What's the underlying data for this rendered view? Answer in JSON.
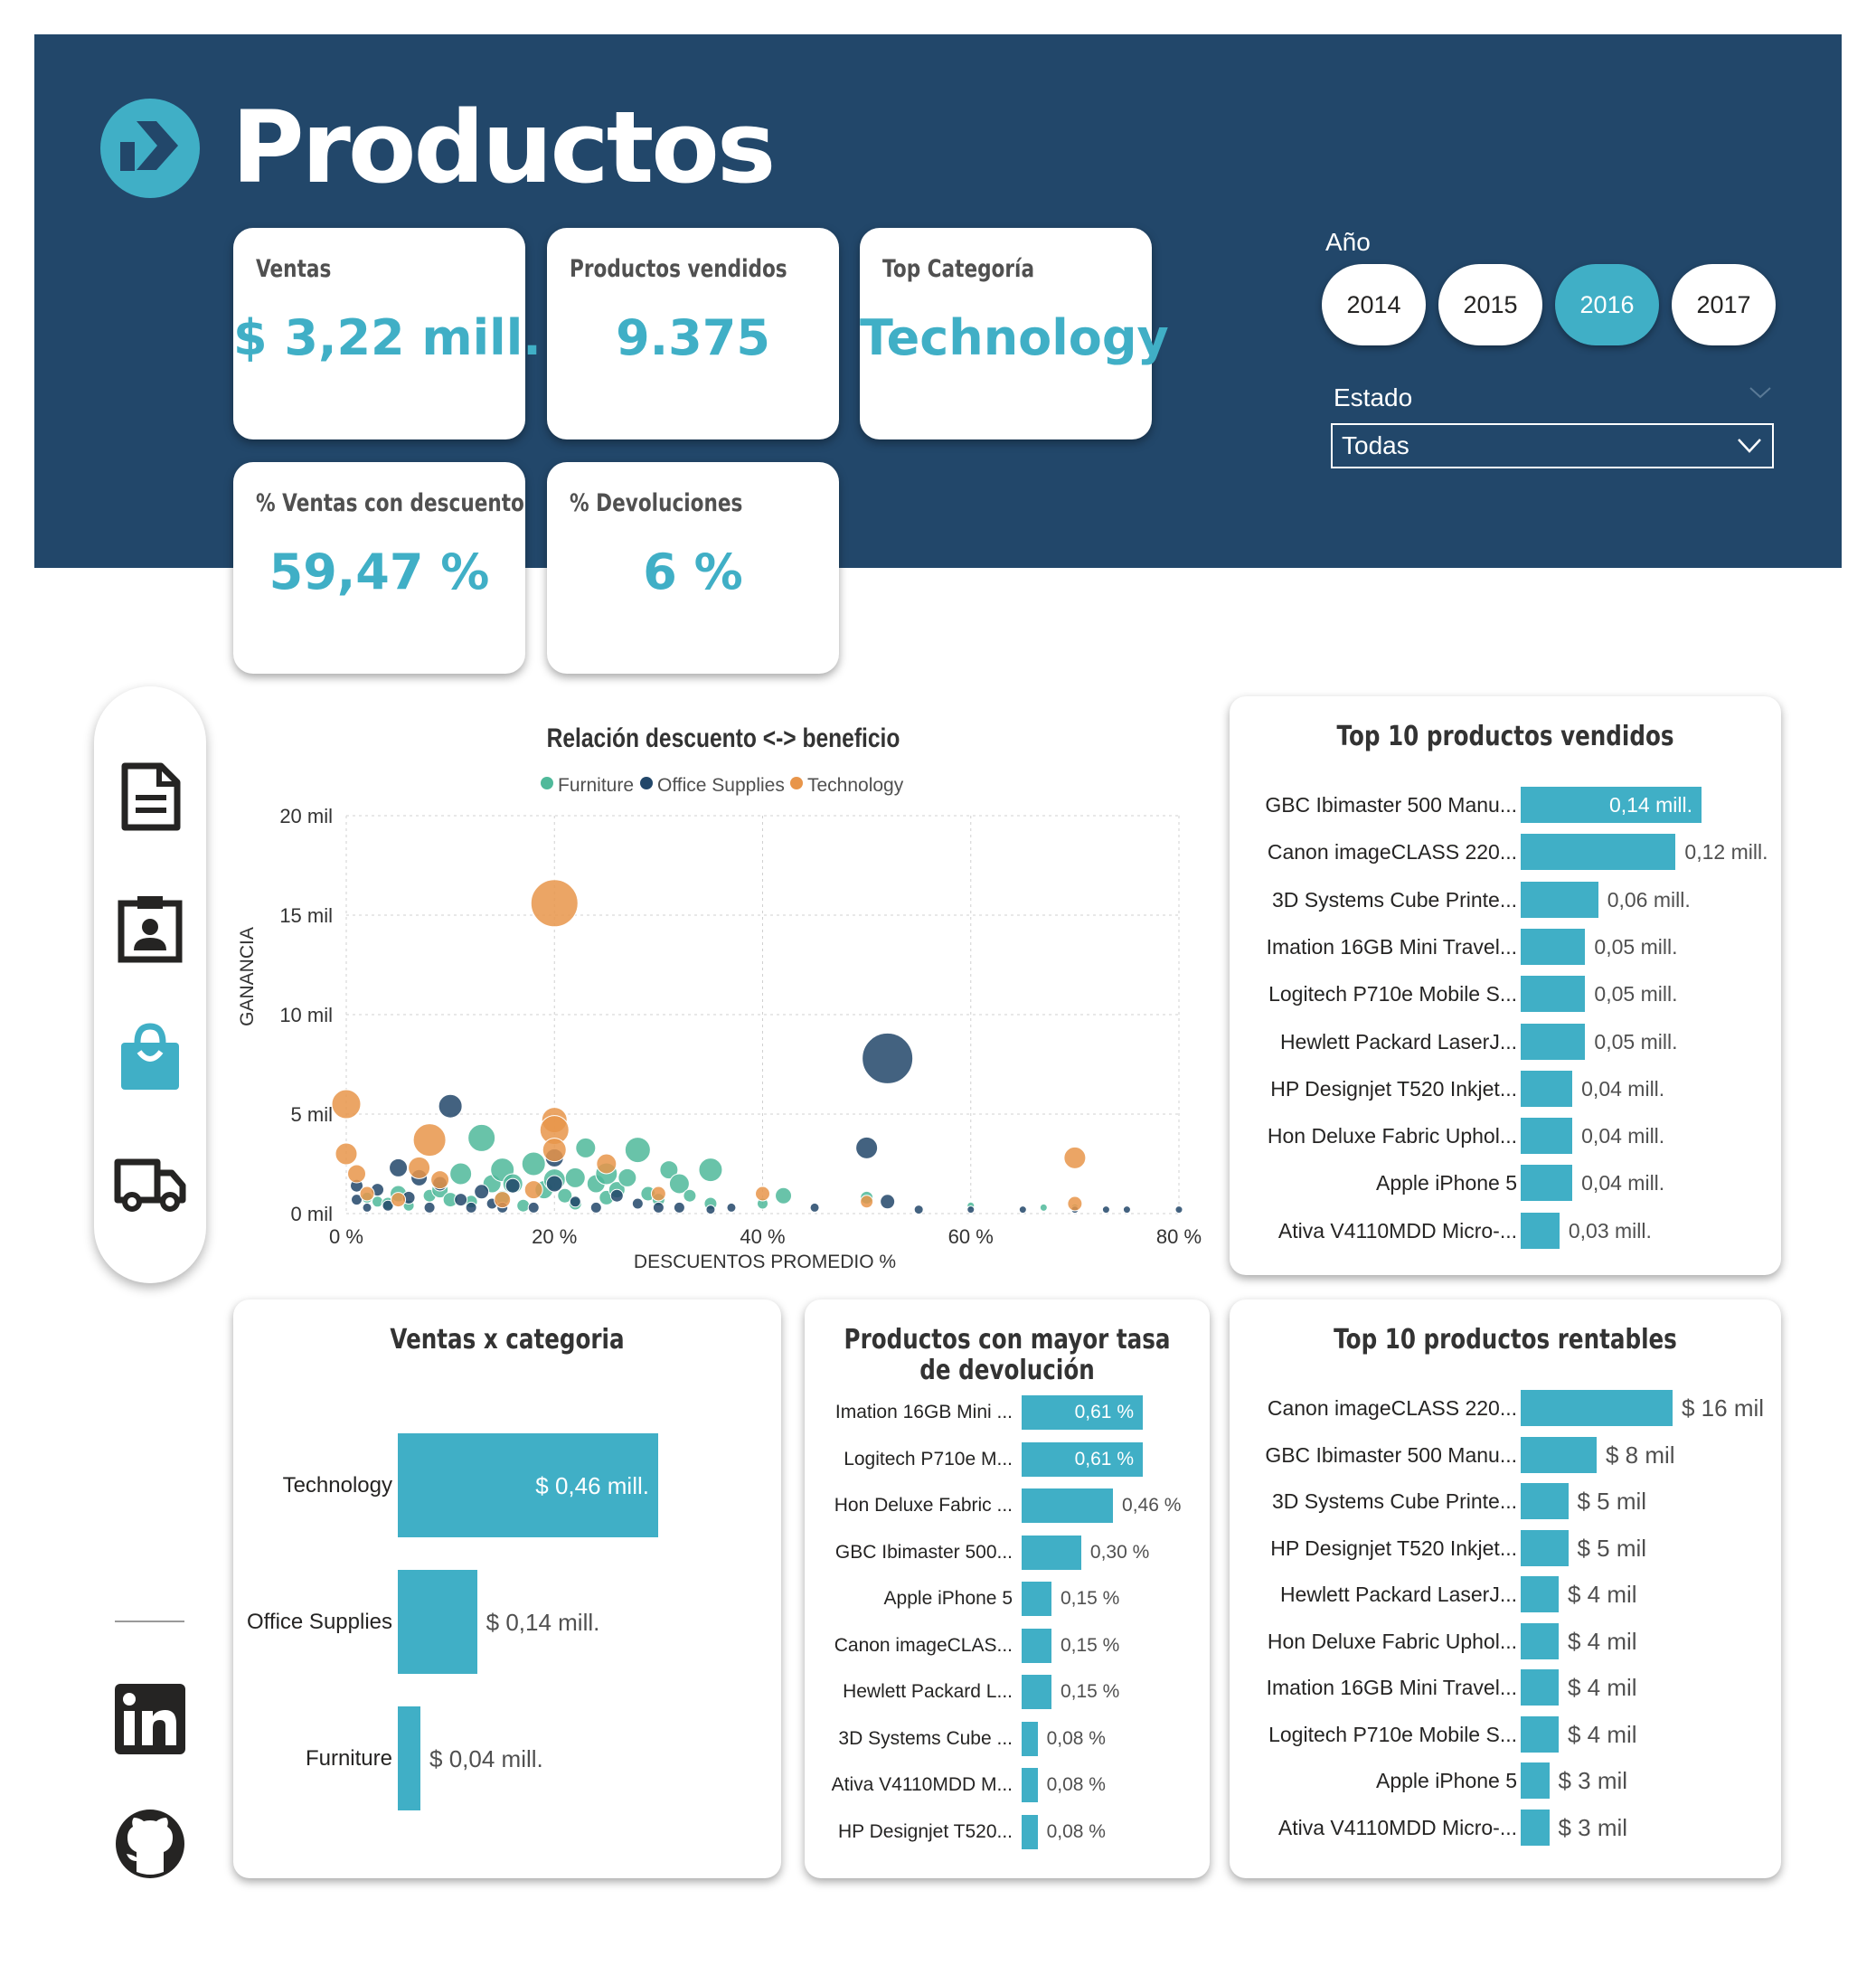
{
  "page_title": "Productos",
  "colors": {
    "header_bg": "#22476a",
    "accent": "#40afc6",
    "furniture": "#4fb99a",
    "office_supplies": "#22476a",
    "technology": "#e8954a"
  },
  "kpis": {
    "ventas": {
      "label": "Ventas",
      "value": "$ 3,22 mill."
    },
    "productos_vendidos": {
      "label": "Productos vendidos",
      "value": "9.375"
    },
    "top_categoria": {
      "label": "Top Categoría",
      "value": "Technology"
    },
    "pct_descuento": {
      "label": "% Ventas con descuento",
      "value": "59,47 %"
    },
    "pct_devoluciones": {
      "label": "% Devoluciones",
      "value": "6 %"
    }
  },
  "filters": {
    "year_label": "Año",
    "years": [
      "2014",
      "2015",
      "2016",
      "2017"
    ],
    "selected_year": "2016",
    "estado_label": "Estado",
    "estado_value": "Todas"
  },
  "nav_icons": [
    "document-icon",
    "contact-badge-icon",
    "shopping-bag-icon",
    "truck-icon"
  ],
  "social_icons": [
    "linkedin-icon",
    "github-icon"
  ],
  "scatter": {
    "title": "Relación descuento <-> beneficio",
    "legend": [
      "Furniture",
      "Office Supplies",
      "Technology"
    ],
    "xlabel": "DESCUENTOS PROMEDIO %",
    "ylabel": "GANANCIA",
    "x_ticks": [
      "0 %",
      "20 %",
      "40 %",
      "60 %",
      "80 %"
    ],
    "y_ticks": [
      "0 mil",
      "5 mil",
      "10 mil",
      "15 mil",
      "20 mil"
    ]
  },
  "top_vendidos": {
    "title": "Top 10 productos vendidos",
    "items": [
      {
        "label": "GBC Ibimaster 500 Manu...",
        "value": "0,14 mill."
      },
      {
        "label": "Canon imageCLASS 220...",
        "value": "0,12 mill."
      },
      {
        "label": "3D Systems Cube Printe...",
        "value": "0,06 mill."
      },
      {
        "label": "Imation 16GB Mini Travel...",
        "value": "0,05 mill."
      },
      {
        "label": "Logitech P710e Mobile S...",
        "value": "0,05 mill."
      },
      {
        "label": "Hewlett Packard LaserJ...",
        "value": "0,05 mill."
      },
      {
        "label": "HP Designjet T520 Inkjet...",
        "value": "0,04 mill."
      },
      {
        "label": "Hon Deluxe Fabric Uphol...",
        "value": "0,04 mill."
      },
      {
        "label": "Apple iPhone 5",
        "value": "0,04 mill."
      },
      {
        "label": "Ativa V4110MDD Micro-...",
        "value": "0,03 mill."
      }
    ]
  },
  "ventas_categoria": {
    "title": "Ventas x categoria",
    "items": [
      {
        "label": "Technology",
        "value": "$ 0,46 mill."
      },
      {
        "label": "Office Supplies",
        "value": "$ 0,14 mill."
      },
      {
        "label": "Furniture",
        "value": "$ 0,04 mill."
      }
    ]
  },
  "devolucion": {
    "title_line1": "Productos con mayor tasa",
    "title_line2": "de devolución",
    "items": [
      {
        "label": "Imation 16GB Mini ...",
        "value": "0,61 %"
      },
      {
        "label": "Logitech P710e M...",
        "value": "0,61 %"
      },
      {
        "label": "Hon Deluxe Fabric ...",
        "value": "0,46 %"
      },
      {
        "label": "GBC Ibimaster 500...",
        "value": "0,30 %"
      },
      {
        "label": "Apple iPhone 5",
        "value": "0,15 %"
      },
      {
        "label": "Canon imageCLAS...",
        "value": "0,15 %"
      },
      {
        "label": "Hewlett Packard L...",
        "value": "0,15 %"
      },
      {
        "label": "3D Systems Cube ...",
        "value": "0,08 %"
      },
      {
        "label": "Ativa V4110MDD M...",
        "value": "0,08 %"
      },
      {
        "label": "HP Designjet T520...",
        "value": "0,08 %"
      }
    ]
  },
  "top_rentables": {
    "title": "Top 10 productos rentables",
    "items": [
      {
        "label": "Canon imageCLASS 220...",
        "value": "$ 16 mil"
      },
      {
        "label": "GBC Ibimaster 500 Manu...",
        "value": "$ 8 mil"
      },
      {
        "label": "3D Systems Cube Printe...",
        "value": "$ 5 mil"
      },
      {
        "label": "HP Designjet T520 Inkjet...",
        "value": "$ 5 mil"
      },
      {
        "label": "Hewlett Packard LaserJ...",
        "value": "$ 4 mil"
      },
      {
        "label": "Hon Deluxe Fabric Uphol...",
        "value": "$ 4 mil"
      },
      {
        "label": "Imation 16GB Mini Travel...",
        "value": "$ 4 mil"
      },
      {
        "label": "Logitech P710e Mobile S...",
        "value": "$ 4 mil"
      },
      {
        "label": "Apple iPhone 5",
        "value": "$ 3 mil"
      },
      {
        "label": "Ativa V4110MDD Micro-...",
        "value": "$ 3 mil"
      }
    ]
  },
  "chart_data": [
    {
      "type": "scatter",
      "title": "Relación descuento <-> beneficio",
      "xlabel": "DESCUENTOS PROMEDIO %",
      "ylabel": "GANANCIA",
      "xlim": [
        0,
        80
      ],
      "ylim": [
        0,
        20000
      ],
      "grid": true,
      "legend": "top",
      "series": [
        {
          "name": "Furniture",
          "points": [
            [
              2,
              800,
              6
            ],
            [
              3,
              600,
              6
            ],
            [
              4,
              500,
              7
            ],
            [
              5,
              1000,
              9
            ],
            [
              6,
              400,
              6
            ],
            [
              8,
              900,
              7
            ],
            [
              9,
              1200,
              9
            ],
            [
              10,
              700,
              8
            ],
            [
              11,
              2000,
              12
            ],
            [
              12,
              600,
              7
            ],
            [
              13,
              3800,
              15
            ],
            [
              14,
              1500,
              10
            ],
            [
              15,
              2200,
              13
            ],
            [
              15,
              800,
              8
            ],
            [
              16,
              1500,
              11
            ],
            [
              17,
              400,
              7
            ],
            [
              18,
              2500,
              13
            ],
            [
              19,
              1200,
              10
            ],
            [
              20,
              1700,
              12
            ],
            [
              21,
              900,
              8
            ],
            [
              22,
              1800,
              11
            ],
            [
              22,
              500,
              7
            ],
            [
              23,
              3300,
              11
            ],
            [
              24,
              1500,
              10
            ],
            [
              25,
              2000,
              12
            ],
            [
              25,
              800,
              8
            ],
            [
              26,
              1200,
              9
            ],
            [
              27,
              1800,
              10
            ],
            [
              28,
              3200,
              14
            ],
            [
              29,
              1000,
              8
            ],
            [
              30,
              700,
              7
            ],
            [
              31,
              2200,
              10
            ],
            [
              32,
              1500,
              11
            ],
            [
              33,
              900,
              7
            ],
            [
              35,
              500,
              7
            ],
            [
              35,
              2200,
              13
            ],
            [
              40,
              500,
              6
            ],
            [
              42,
              900,
              9
            ],
            [
              50,
              800,
              7
            ],
            [
              60,
              400,
              4
            ],
            [
              67,
              300,
              4
            ],
            [
              70,
              300,
              4
            ]
          ]
        },
        {
          "name": "Office Supplies",
          "points": [
            [
              1,
              1400,
              7
            ],
            [
              1,
              700,
              6
            ],
            [
              2,
              300,
              5
            ],
            [
              3,
              1200,
              7
            ],
            [
              4,
              400,
              6
            ],
            [
              5,
              2300,
              10
            ],
            [
              6,
              800,
              7
            ],
            [
              7,
              1800,
              9
            ],
            [
              8,
              300,
              6
            ],
            [
              9,
              1500,
              8
            ],
            [
              10,
              5400,
              13
            ],
            [
              11,
              700,
              7
            ],
            [
              12,
              300,
              6
            ],
            [
              13,
              1100,
              8
            ],
            [
              14,
              500,
              6
            ],
            [
              15,
              300,
              6
            ],
            [
              16,
              1400,
              8
            ],
            [
              18,
              300,
              6
            ],
            [
              20,
              2800,
              10
            ],
            [
              20,
              1500,
              9
            ],
            [
              22,
              600,
              6
            ],
            [
              24,
              300,
              6
            ],
            [
              26,
              900,
              7
            ],
            [
              28,
              500,
              6
            ],
            [
              30,
              300,
              6
            ],
            [
              32,
              300,
              6
            ],
            [
              35,
              200,
              5
            ],
            [
              37,
              300,
              5
            ],
            [
              45,
              300,
              5
            ],
            [
              50,
              3300,
              12
            ],
            [
              52,
              7800,
              28
            ],
            [
              52,
              600,
              8
            ],
            [
              55,
              200,
              5
            ],
            [
              60,
              200,
              4
            ],
            [
              65,
              200,
              4
            ],
            [
              70,
              200,
              4
            ],
            [
              73,
              200,
              4
            ],
            [
              75,
              200,
              4
            ],
            [
              80,
              200,
              4
            ]
          ]
        },
        {
          "name": "Technology",
          "points": [
            [
              0,
              5500,
              16
            ],
            [
              0,
              3000,
              12
            ],
            [
              1,
              2000,
              10
            ],
            [
              2,
              1000,
              8
            ],
            [
              5,
              700,
              8
            ],
            [
              7,
              2300,
              12
            ],
            [
              8,
              3700,
              18
            ],
            [
              9,
              1700,
              10
            ],
            [
              15,
              700,
              9
            ],
            [
              18,
              1200,
              10
            ],
            [
              20,
              15600,
              26
            ],
            [
              20,
              4700,
              14
            ],
            [
              20,
              4200,
              16
            ],
            [
              20,
              3200,
              13
            ],
            [
              25,
              2500,
              11
            ],
            [
              30,
              1000,
              8
            ],
            [
              40,
              1000,
              8
            ],
            [
              50,
              600,
              7
            ],
            [
              70,
              2800,
              12
            ],
            [
              70,
              500,
              8
            ]
          ]
        }
      ]
    },
    {
      "type": "bar",
      "title": "Top 10 productos vendidos",
      "categories": [
        "GBC Ibimaster 500 Manu...",
        "Canon imageCLASS 220...",
        "3D Systems Cube Printe...",
        "Imation 16GB Mini Travel...",
        "Logitech P710e Mobile S...",
        "Hewlett Packard LaserJ...",
        "HP Designjet T520 Inkjet...",
        "Hon Deluxe Fabric Uphol...",
        "Apple iPhone 5",
        "Ativa V4110MDD Micro-..."
      ],
      "values": [
        0.14,
        0.12,
        0.06,
        0.05,
        0.05,
        0.05,
        0.04,
        0.04,
        0.04,
        0.03
      ]
    },
    {
      "type": "bar",
      "title": "Ventas x categoria",
      "categories": [
        "Technology",
        "Office Supplies",
        "Furniture"
      ],
      "values": [
        0.46,
        0.14,
        0.04
      ]
    },
    {
      "type": "bar",
      "title": "Productos con mayor tasa de devolución",
      "categories": [
        "Imation 16GB Mini ...",
        "Logitech P710e M...",
        "Hon Deluxe Fabric ...",
        "GBC Ibimaster 500...",
        "Apple iPhone 5",
        "Canon imageCLAS...",
        "Hewlett Packard L...",
        "3D Systems Cube ...",
        "Ativa V4110MDD M...",
        "HP Designjet T520..."
      ],
      "values": [
        0.61,
        0.61,
        0.46,
        0.3,
        0.15,
        0.15,
        0.15,
        0.08,
        0.08,
        0.08
      ]
    },
    {
      "type": "bar",
      "title": "Top 10 productos rentables",
      "categories": [
        "Canon imageCLASS 220...",
        "GBC Ibimaster 500 Manu...",
        "3D Systems Cube Printe...",
        "HP Designjet T520 Inkjet...",
        "Hewlett Packard LaserJ...",
        "Hon Deluxe Fabric Uphol...",
        "Imation 16GB Mini Travel...",
        "Logitech P710e Mobile S...",
        "Apple iPhone 5",
        "Ativa V4110MDD Micro-..."
      ],
      "values": [
        16,
        8,
        5,
        5,
        4,
        4,
        4,
        4,
        3,
        3
      ]
    }
  ]
}
